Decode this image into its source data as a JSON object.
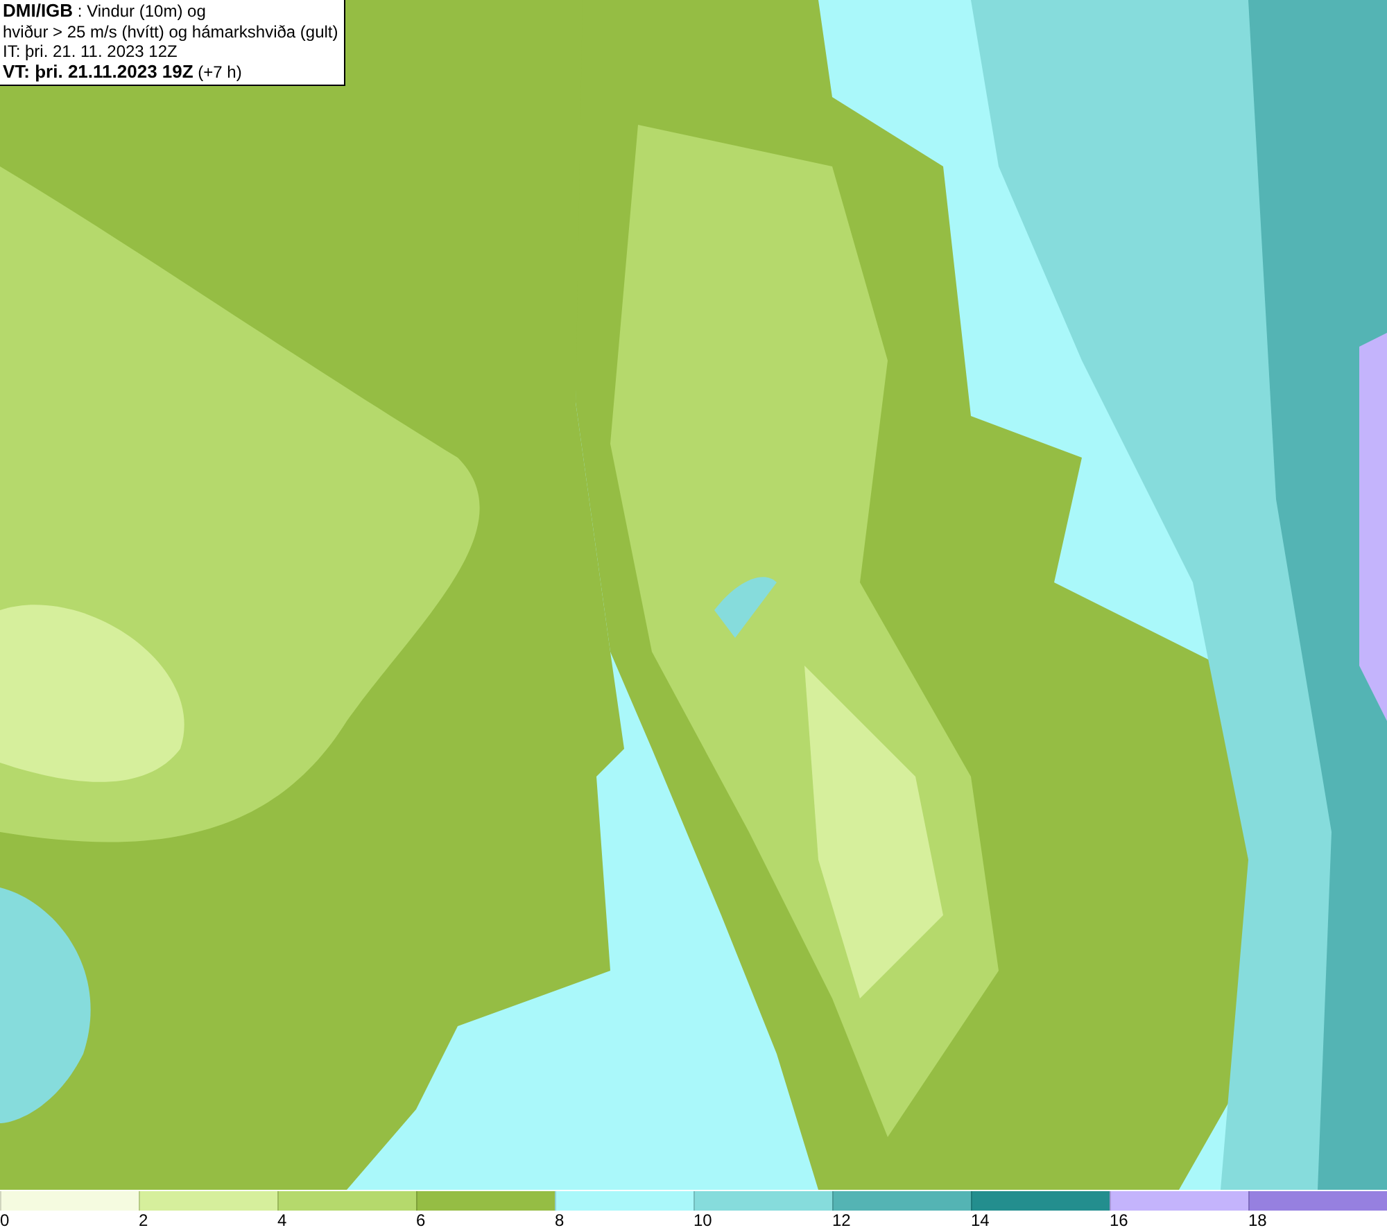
{
  "header": {
    "lines": [
      "**DMI/IGB** : Vindur (10m) og",
      "hviður > 25 m/s (hvítt) og hámarkshviða (gult)",
      "IT: þri. 21. 11. 2023 12Z",
      "**VT: þri. 21.11.2023 19Z** (+7 h)"
    ]
  },
  "legend": {
    "swatches": [
      {
        "color": "#f5fbe0"
      },
      {
        "color": "#d6ef9c"
      },
      {
        "color": "#b5d96c"
      },
      {
        "color": "#95bd44"
      },
      {
        "color": "#aaf8fa"
      },
      {
        "color": "#86dcdc"
      },
      {
        "color": "#54b4b4"
      },
      {
        "color": "#238e8e"
      },
      {
        "color": "#c4b4fc"
      },
      {
        "color": "#9680e0"
      }
    ],
    "labels": [
      "0",
      "2",
      "4",
      "6",
      "8",
      "10",
      "12",
      "14",
      "16",
      "18"
    ]
  }
}
